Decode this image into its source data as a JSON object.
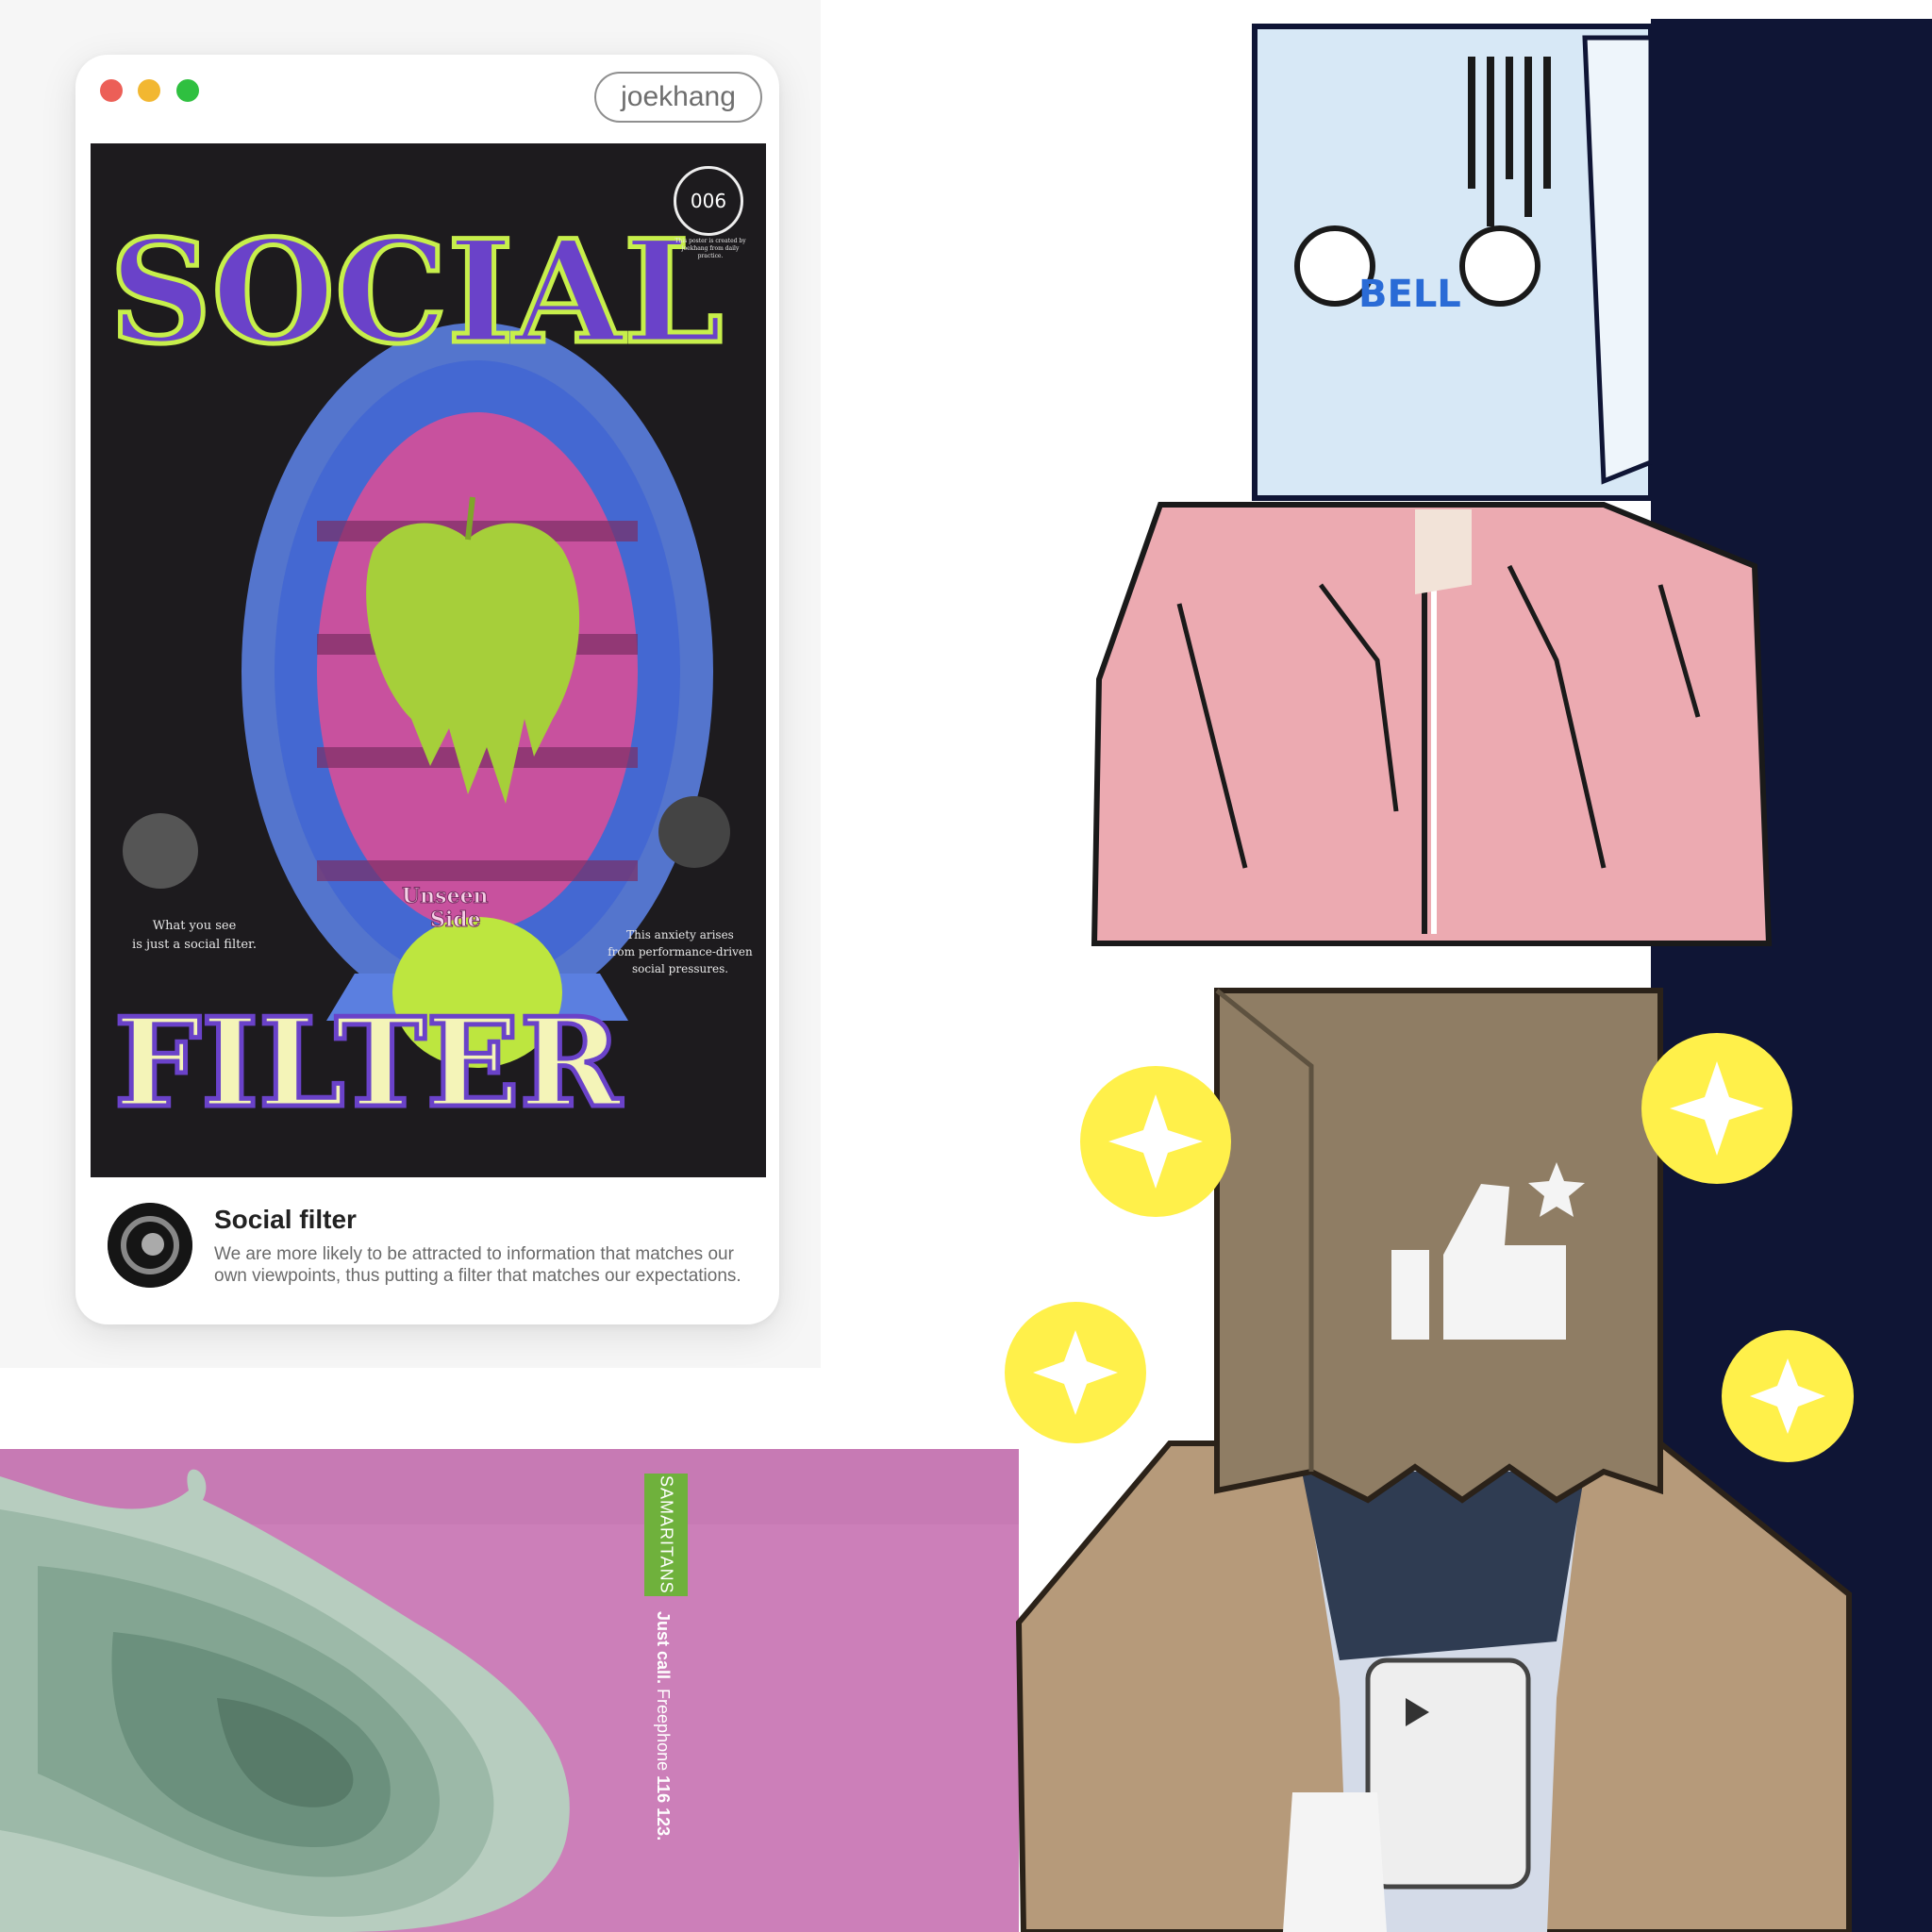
{
  "card": {
    "username": "joekhang",
    "badge_number": "006",
    "badge_caption": "This poster is created by joekhang from daily practice.",
    "poster_title_top": "SOCIAL",
    "poster_title_bottom": "FILTER",
    "apple_label_line1": "Unseen",
    "apple_label_line2": "Side",
    "left_caption_line1": "What you see",
    "left_caption_line2": "is just a social filter.",
    "right_caption_line1": "This anxiety arises",
    "right_caption_line2": "from performance-driven",
    "right_caption_line3": "social pressures.",
    "title": "Social filter",
    "description": "We are more likely to be attracted to information that matches our own viewpoints, thus putting a filter that matches our expectations."
  },
  "samaritans": {
    "brand": "SAMARITANS",
    "tagline_bold": "Just call.",
    "tagline_rest": " Freephone ",
    "phone": "116 123."
  },
  "icons": [
    "thumbs-up-icon",
    "star-icon",
    "sparkle-icon",
    "play-icon"
  ],
  "colors": {
    "pink_bg": "#cc7fb9",
    "navy_bg": "#0f1535",
    "pink_jacket": "#ecaab1",
    "brown_jacket": "#b69a7a",
    "paper_bag": "#8f7d64",
    "samaritans_green": "#6fb13c"
  }
}
